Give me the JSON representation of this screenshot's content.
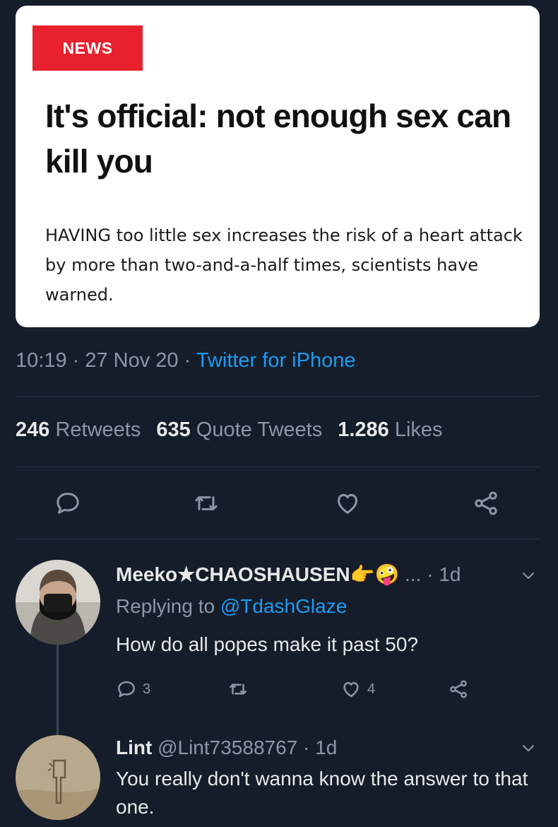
{
  "article": {
    "badge": "NEWS",
    "headline": "It's official: not enough sex can kill you",
    "summary": "HAVING too little sex increases the risk of a heart attack by more than two-and-a-half times, scientists have warned."
  },
  "tweet_meta": {
    "time": "10:19",
    "sep1": " · ",
    "date": "27 Nov 20",
    "sep2": " · ",
    "source": "Twitter for iPhone"
  },
  "stats": {
    "retweets_count": "246",
    "retweets_label": " Retweets",
    "quotes_count": "635",
    "quotes_label": " Quote Tweets",
    "likes_count": "1.286",
    "likes_label": " Likes"
  },
  "actions": {
    "icons": [
      "reply-icon",
      "retweet-icon",
      "like-icon",
      "share-icon"
    ]
  },
  "replies": [
    {
      "name": "Meeko★CHAOSHAUSEN",
      "emoji": "👉🤪",
      "ellipsis": " ...",
      "time": " · 1d",
      "replying_prefix": "Replying to ",
      "replying_handle": "@TdashGlaze",
      "text": "How do all popes make it past 50?",
      "reply_count": "3",
      "like_count": "4"
    },
    {
      "name": "Lint",
      "handle": " @Lint73588767",
      "time": " · 1d",
      "text": "You really don't wanna know the answer to that one."
    }
  ],
  "colors": {
    "background": "#151d2b",
    "accent": "#1d9bf0",
    "secondary_text": "#8b98a5",
    "badge_red": "#e8212e"
  }
}
